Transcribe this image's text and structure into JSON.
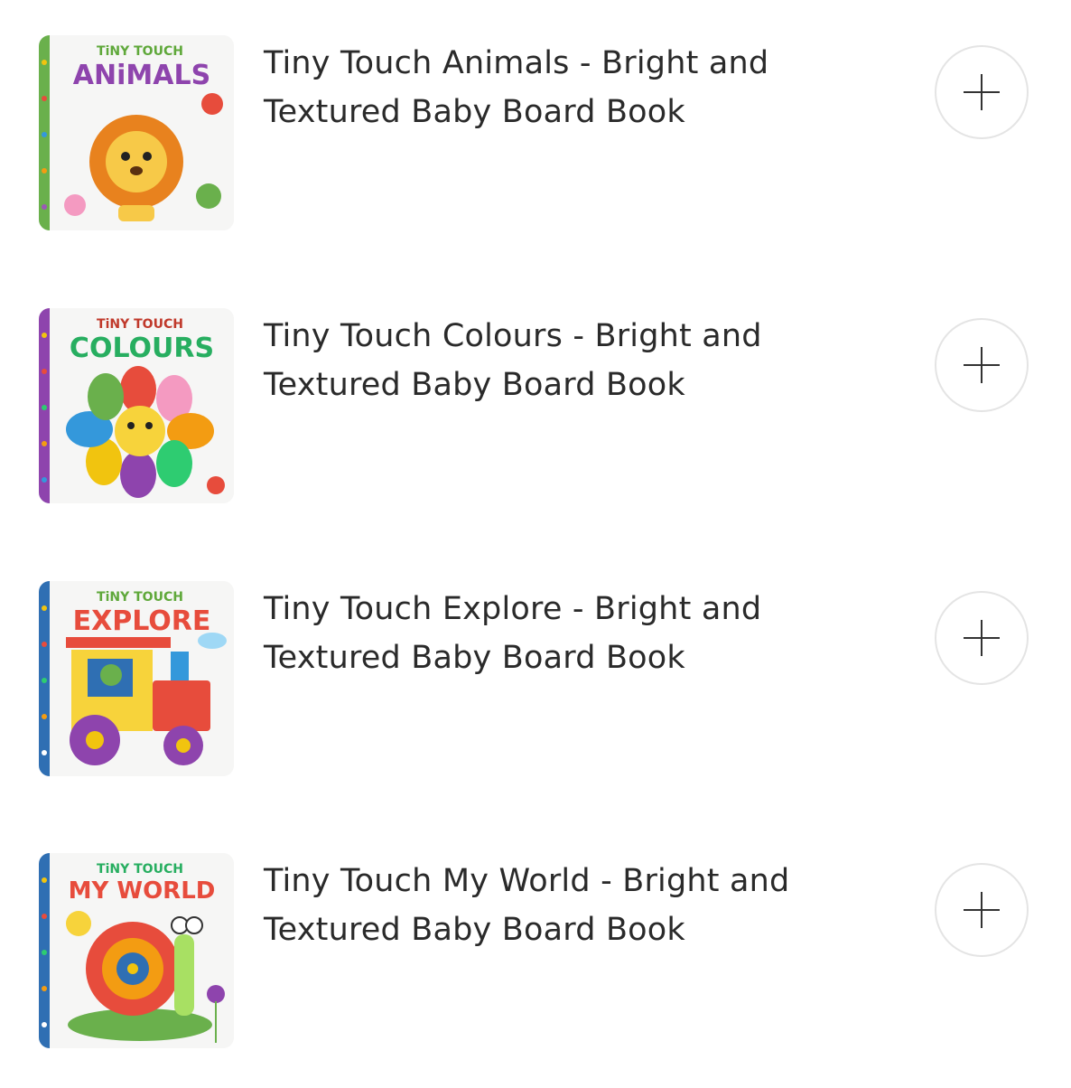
{
  "products": [
    {
      "title": "Tiny Touch Animals - Bright and Textured Baby Board Book",
      "cover": {
        "series": "TiNY TOUCH",
        "word": "ANiMALS",
        "spine_color": "#6ab04c"
      },
      "add_icon": "plus-icon"
    },
    {
      "title": "Tiny Touch Colours - Bright and Textured Baby Board Book",
      "cover": {
        "series": "TiNY TOUCH",
        "word": "COLOURS",
        "spine_color": "#8e44ad"
      },
      "add_icon": "plus-icon"
    },
    {
      "title": "Tiny Touch Explore - Bright and Textured Baby Board Book",
      "cover": {
        "series": "TiNY TOUCH",
        "word": "EXPLORE",
        "spine_color": "#2f6fb3"
      },
      "add_icon": "plus-icon"
    },
    {
      "title": "Tiny Touch My World - Bright and Textured Baby Board Book",
      "cover": {
        "series": "TiNY TOUCH",
        "word": "MY WORLD",
        "spine_color": "#2f6fb3"
      },
      "add_icon": "plus-icon"
    }
  ]
}
